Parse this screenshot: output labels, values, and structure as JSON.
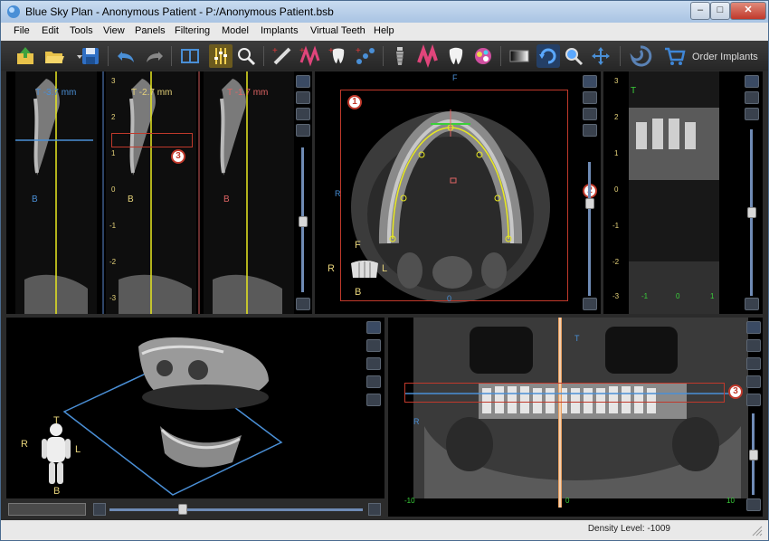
{
  "window": {
    "title": "Blue Sky Plan - Anonymous Patient - P:/Anonymous Patient.bsb"
  },
  "menu": [
    "File",
    "Edit",
    "Tools",
    "View",
    "Panels",
    "Filtering",
    "Model",
    "Implants",
    "Virtual Teeth",
    "Help"
  ],
  "toolbar": {
    "order_implants": "Order Implants"
  },
  "cross_sections": {
    "label_T": "T",
    "label_B": "B",
    "values": [
      "-3.7 mm",
      "-2.7 mm",
      "-1.7 mm"
    ],
    "ruler": [
      "3",
      "2",
      "1",
      "0",
      "-1",
      "-2",
      "-3"
    ]
  },
  "axial": {
    "F": "F",
    "R": "R",
    "L": "L",
    "B": "B",
    "zero": "0"
  },
  "panoramic": {
    "T": "T",
    "R": "R",
    "x_ticks": [
      "-10",
      "0",
      "10"
    ]
  },
  "coronal": {
    "T": "T",
    "x_ticks": [
      "-1",
      "0",
      "1"
    ],
    "y_ticks": [
      "3",
      "2",
      "1",
      "0",
      "-1",
      "-2",
      "-3"
    ]
  },
  "view3d": {
    "R": "R",
    "L": "L",
    "T": "T",
    "B": "B"
  },
  "callouts": [
    "1",
    "2",
    "3",
    "3"
  ],
  "status": {
    "density": "Density Level: -1009"
  },
  "colors": {
    "accent": "#4a8fd6",
    "curve": "#e8e820",
    "highlight": "#c0392b"
  }
}
